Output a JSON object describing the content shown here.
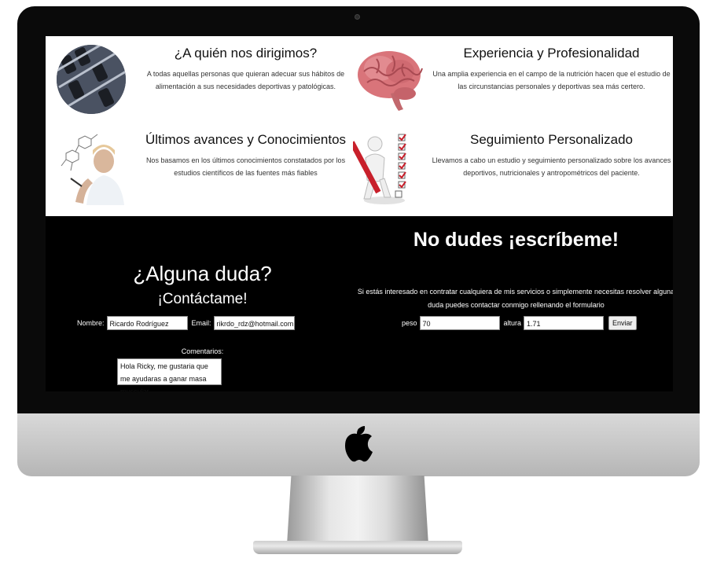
{
  "features": [
    {
      "title": "¿A quién nos dirigimos?",
      "text": "A todas aquellas personas que quieran adecuar sus hábitos de alimentación a sus necesidades deportivas y patológicas.",
      "image_icon": "dumbbells-photo"
    },
    {
      "title": "Experiencia y Profesionalidad",
      "text": "Una amplia experiencia en el campo de la nutrición hacen que el estudio de las circunstancias personales y deportivas sea más certero.",
      "image_icon": "brain-photo"
    },
    {
      "title": "Últimos avances y Conocimientos",
      "text": "Nos basamos en los últimos conocimientos constatados por los estudios científicos de las fuentes más fiables",
      "image_icon": "scientist-molecule-photo"
    },
    {
      "title": "Seguimiento Personalizado",
      "text": "Llevamos a cabo un estudio y seguimiento personalizado sobre los avances deportivos, nutricionales y antropométricos del paciente.",
      "image_icon": "checklist-figure-photo"
    }
  ],
  "contact": {
    "heading": "¿Alguna duda?",
    "subheading": "¡Contáctame!",
    "name_label": "Nombre:",
    "name_value": "Ricardo Rodríguez",
    "email_label": "Email:",
    "email_value": "rikrdo_rdz@hotmail.com",
    "comments_label": "Comentarios:",
    "comments_value": "Hola Ricky, me gustaria que me ayudaras a ganar masa muscular."
  },
  "bmi": {
    "heading": "No dudes ¡escríbeme!",
    "text": "Si estás interesado en contratar cualquiera de mis servicios o simplemente necesitas resolver alguna duda puedes contactar conmigo rellenando el formulario",
    "weight_label": "peso",
    "weight_value": "70",
    "height_label": "altura",
    "height_value": "1.71",
    "submit_label": "Enviar"
  },
  "colors": {
    "screen_bg": "#000000",
    "features_bg": "#ffffff",
    "bezel": "#0a0a0a",
    "chin": "#c9c9c9"
  }
}
